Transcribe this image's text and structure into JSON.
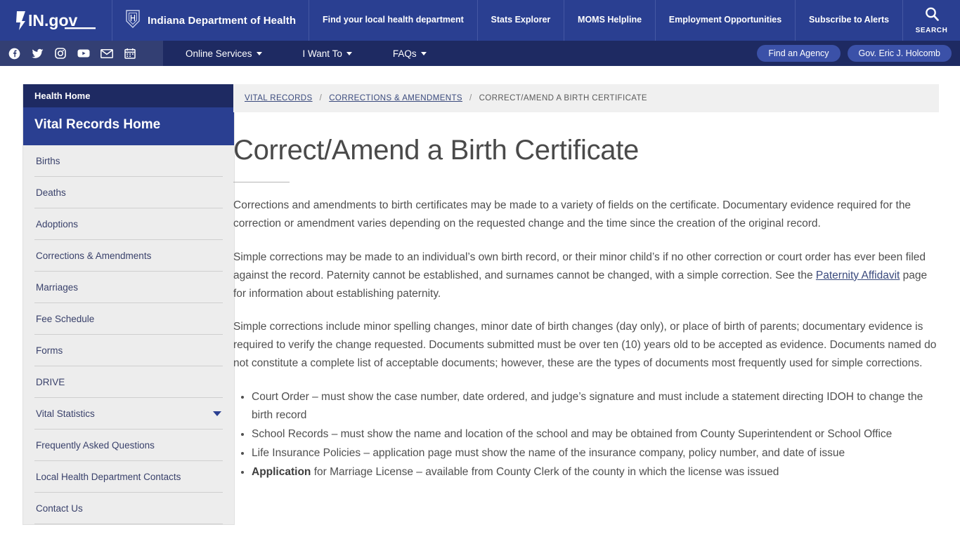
{
  "header": {
    "logo_text": "IN.gov",
    "logo_icon": "indiana-state-outline-icon",
    "agency_icon": "idoh-shield-icon",
    "agency_name": "Indiana Department of Health",
    "nav_items": [
      {
        "label": "Find your local health department"
      },
      {
        "label": "Stats Explorer"
      },
      {
        "label": "MOMS Helpline"
      },
      {
        "label": "Employment Opportunities"
      },
      {
        "label": "Subscribe to Alerts"
      }
    ],
    "search": {
      "label": "SEARCH",
      "icon": "search-icon"
    }
  },
  "secondary_bar": {
    "social_icons": [
      {
        "name": "facebook-icon"
      },
      {
        "name": "twitter-icon"
      },
      {
        "name": "instagram-icon"
      },
      {
        "name": "youtube-icon"
      },
      {
        "name": "email-icon"
      },
      {
        "name": "calendar-icon"
      }
    ],
    "menus": [
      {
        "label": "Online Services"
      },
      {
        "label": "I Want To"
      },
      {
        "label": "FAQs"
      }
    ],
    "buttons": [
      {
        "label": "Find an Agency"
      },
      {
        "label": "Gov. Eric J. Holcomb"
      }
    ]
  },
  "sidebar": {
    "home_label": "Health Home",
    "section_title": "Vital Records Home",
    "items": [
      {
        "label": "Births",
        "has_caret": false
      },
      {
        "label": "Deaths",
        "has_caret": false
      },
      {
        "label": "Adoptions",
        "has_caret": false
      },
      {
        "label": "Corrections & Amendments",
        "has_caret": false
      },
      {
        "label": "Marriages",
        "has_caret": false
      },
      {
        "label": "Fee Schedule",
        "has_caret": false
      },
      {
        "label": "Forms",
        "has_caret": false
      },
      {
        "label": "DRIVE",
        "has_caret": false
      },
      {
        "label": "Vital Statistics",
        "has_caret": true
      },
      {
        "label": "Frequently Asked Questions",
        "has_caret": false
      },
      {
        "label": "Local Health Department Contacts",
        "has_caret": false
      },
      {
        "label": "Contact Us",
        "has_caret": false
      }
    ]
  },
  "breadcrumb": {
    "items": [
      {
        "label": "VITAL RECORDS",
        "link": true
      },
      {
        "label": "CORRECTIONS & AMENDMENTS",
        "link": true
      },
      {
        "label": "CORRECT/AMEND A BIRTH CERTIFICATE",
        "link": false
      }
    ],
    "separator": "/"
  },
  "main": {
    "title": "Correct/Amend a Birth Certificate",
    "paragraph_1": "Corrections and amendments to birth certificates may be made to a variety of fields on the certificate. Documentary evidence required for the correction or amendment varies depending on the requested change and the time since the creation of the original record.",
    "paragraph_2_part1": "Simple corrections may be made to an individual’s own birth record, or their minor child’s if no other correction or court order has ever been filed against the record. Paternity cannot be established, and surnames cannot be changed, with a simple correction. See the ",
    "paragraph_2_link": "Paternity Affidavit",
    "paragraph_2_part2": " page for information about establishing paternity.",
    "paragraph_3": "Simple corrections include minor spelling changes, minor date of birth changes (day only), or place of birth of parents; documentary evidence is required to verify the change requested. Documents submitted must be over ten (10) years old to be accepted as evidence. Documents named do not constitute a complete list of acceptable documents; however, these are the types of documents most frequently used for simple corrections.",
    "list_items": [
      {
        "bold": "",
        "text": "Court Order – must show the case number, date ordered, and judge’s signature and must include a statement directing IDOH to change the birth record"
      },
      {
        "bold": "",
        "text": "School Records – must show the name and location of the school and may be obtained from County Superintendent or School Office"
      },
      {
        "bold": "",
        "text": "Life Insurance Policies – application page must show the name of the insurance company, policy number, and date of issue"
      },
      {
        "bold": "Application",
        "text": " for Marriage License – available from County Clerk of the county in which the license was issued"
      }
    ]
  },
  "colors": {
    "header_blue": "#2a3f91",
    "dark_navy": "#1e2a62",
    "social_bar": "#333f73",
    "pill_blue": "#3b51a8",
    "sidebar_bg": "#ededed",
    "breadcrumb_bg": "#f0f0f0",
    "link_navy": "#3a4a7d",
    "body_text": "#4f4f4f"
  }
}
